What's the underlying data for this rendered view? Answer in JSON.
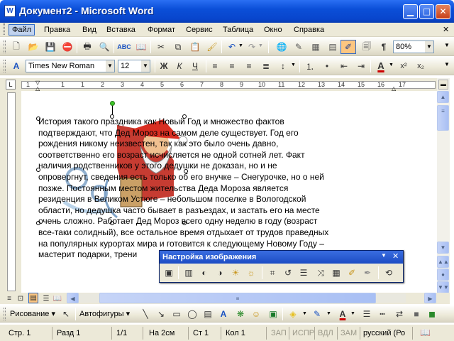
{
  "window": {
    "title": "Документ2 - Microsoft Word",
    "app_icon": "W"
  },
  "menu": [
    "Файл",
    "Правка",
    "Вид",
    "Вставка",
    "Формат",
    "Сервис",
    "Таблица",
    "Окно",
    "Справка"
  ],
  "standard_toolbar": {
    "zoom": "80%"
  },
  "format_toolbar": {
    "font": "Times New Roman",
    "size": "12",
    "bold": "Ж",
    "italic": "К",
    "underline": "Ч",
    "font_color_letter": "A"
  },
  "ruler_numbers": [
    "1",
    "2",
    "1",
    "1",
    "2",
    "3",
    "4",
    "5",
    "6",
    "7",
    "8",
    "9",
    "10",
    "11",
    "12",
    "13",
    "14",
    "15",
    "16",
    "17"
  ],
  "document_lines": [
    "История такого праздника как Новый Год и множество фактов",
    "подтверждают, что Дед Мороз на самом деле существует. Год его",
    "рождения никому неизвестен, так как это было очень давно,",
    "соответственно его возраст исчисляется не одной сотней лет. Факт",
    "наличия родственников у этого дедушки не доказан, но и не",
    "опровергнут, сведения есть только об его внучке – Снегурочке, но о ней",
    "позже. Постоянным местом жительства Деда Мороза является",
    "резиденция в Великом Устюге – небольшом поселке в Вологодской",
    "области, но дедушка часто бывает в разъездах, и застать его на месте",
    "очень сложно. Работает Дед Мороз всего одну неделю в году (возраст",
    "все-таки солидный), все остальное время отдыхает от трудов праведных",
    "на популярных курортах мира и готовится к следующему Новому Году –",
    "мастерит подарки, трени"
  ],
  "picture_toolbar": {
    "title": "Настройка изображения"
  },
  "drawing_toolbar": {
    "draw_label": "Рисование",
    "autoshapes_label": "Автофигуры"
  },
  "status_bar": {
    "page": "Стр. 1",
    "section": "Разд 1",
    "pages": "1/1",
    "at": "На 2см",
    "line": "Ст 1",
    "column": "Кол 1",
    "rec": "ЗАП",
    "trk": "ИСПР",
    "ext": "ВДЛ",
    "ovr": "ЗАМ",
    "language": "русский (Ро"
  },
  "colors": {
    "titlebar": "#0b4fd8",
    "accent": "#316ac5",
    "chrome": "#ece9d8",
    "close": "#c73f1a"
  }
}
